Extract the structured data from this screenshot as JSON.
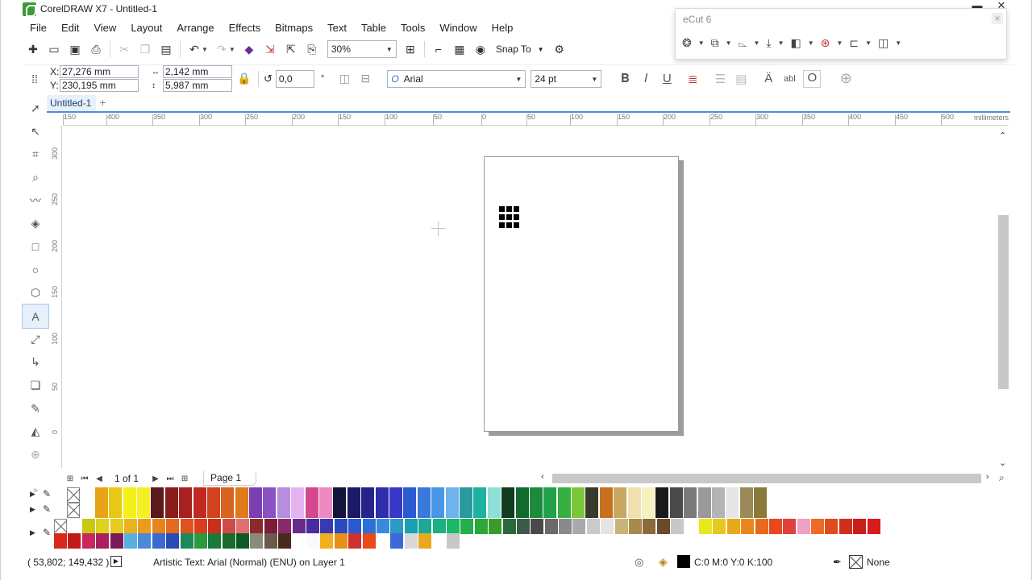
{
  "window": {
    "title": "CorelDRAW X7 - Untitled-1"
  },
  "menu": [
    "File",
    "Edit",
    "View",
    "Layout",
    "Arrange",
    "Effects",
    "Bitmaps",
    "Text",
    "Table",
    "Tools",
    "Window",
    "Help"
  ],
  "toolbar": {
    "zoom_value": "30%",
    "snap_label": "Snap To"
  },
  "ecut": {
    "title": "eCut 6"
  },
  "properties": {
    "x_label": "X:",
    "x_value": "27,276 mm",
    "y_label": "Y:",
    "y_value": "230,195 mm",
    "width_value": "2,142 mm",
    "height_value": "5,987 mm",
    "angle_value": "0,0",
    "angle_unit": "°",
    "font_name": "Arial",
    "font_size": "24 pt"
  },
  "document": {
    "tab_label": "Untitled-1"
  },
  "hruler": {
    "ticks": [
      "150",
      "400",
      "350",
      "300",
      "250",
      "200",
      "150",
      "100",
      "50",
      "0",
      "50",
      "100",
      "150",
      "200",
      "250",
      "300",
      "350",
      "400",
      "450",
      "500"
    ],
    "units": "millimeters"
  },
  "vruler": {
    "ticks": [
      "300",
      "250",
      "200",
      "150",
      "100",
      "50",
      "0"
    ],
    "units": "millimeters"
  },
  "page_nav": {
    "count": "1 of 1",
    "page_tab": "Page 1"
  },
  "palette": {
    "row1": [
      "#ffffff",
      "#e8a417",
      "#e8c814",
      "#f5f01a",
      "#f5f026",
      "#5a1a1a",
      "#8a1c1c",
      "#a82020",
      "#c02a22",
      "#d0431e",
      "#d96420",
      "#e07a1c",
      "#7a3fb0",
      "#8b52c5",
      "#b58ee0",
      "#e3b4f0",
      "#d4488e",
      "#ee88c0",
      "#14143a",
      "#1a1a66",
      "#24248a",
      "#2e2eaa",
      "#3838c8",
      "#2c5ad0",
      "#3a78dc",
      "#4a96e6",
      "#70b2ee",
      "#2a9a9e",
      "#1eb2a2",
      "#8ee0d6",
      "#123c20",
      "#126a2e",
      "#1a8c3c",
      "#22a04a",
      "#36b040",
      "#7ac83a",
      "#3a3a2a",
      "#c87020",
      "#c8a860",
      "#f0e0b0",
      "#f6f0c0",
      "#1a1a1a",
      "#4a4a4a",
      "#7a7a7a",
      "#9a9a9a",
      "#b4b4b4",
      "#e6e6e6",
      "#9a8a5a",
      "#8a7a3a"
    ],
    "row2": [
      "#ffffff",
      "#e8a417",
      "#e8c814",
      "#f5f01a",
      "#f5f026",
      "#5a1a1a",
      "#8a1c1c",
      "#a82020",
      "#c02a22",
      "#d0431e",
      "#d96420",
      "#e07a1c",
      "#7a3fb0",
      "#8b52c5",
      "#b58ee0",
      "#e3b4f0",
      "#d4488e",
      "#ee88c0",
      "#14143a",
      "#1a1a66",
      "#24248a",
      "#2e2eaa",
      "#3838c8",
      "#2c5ad0",
      "#3a78dc",
      "#4a96e6",
      "#70b2ee",
      "#2a9a9e",
      "#1eb2a2",
      "#8ee0d6",
      "#123c20",
      "#126a2e",
      "#1a8c3c",
      "#22a04a",
      "#36b040",
      "#7ac83a",
      "#3a3a2a",
      "#c87020",
      "#c8a860",
      "#f0e0b0",
      "#f6f0c0",
      "#1a1a1a",
      "#4a4a4a",
      "#7a7a7a",
      "#9a9a9a",
      "#b4b4b4",
      "#e6e6e6",
      "#9a8a5a",
      "#8a7a3a"
    ],
    "row3": [
      "#ffffff",
      "#c8c814",
      "#dcd41c",
      "#e4cc20",
      "#e8b41c",
      "#ec9c1a",
      "#e8841c",
      "#e46a1e",
      "#e0521e",
      "#d83e1e",
      "#cc2e1e",
      "#d04a4a",
      "#e07070",
      "#8a2a2a",
      "#7a1c3a",
      "#8a2a6a",
      "#6a2a8a",
      "#4a2aa0",
      "#3a3ab0",
      "#2a4ac0",
      "#2a5ad0",
      "#2a70d8",
      "#3a8adc",
      "#2a9ac8",
      "#1aa0b0",
      "#1aa89a",
      "#1ab084",
      "#1ab868",
      "#22b04a",
      "#2aa83a",
      "#3a9a2a",
      "#2a6a3a",
      "#3a5a4a",
      "#4a4a4a",
      "#6a6a6a",
      "#8a8a8a",
      "#aaaaaa",
      "#cacaca",
      "#e4e4e4",
      "#c8b478",
      "#a88a4a",
      "#8a6a3a",
      "#6a4a2a",
      "#c8c8c8",
      "#ffffff",
      "#e8e81c",
      "#e8c81c",
      "#e8a81c",
      "#e8881c",
      "#e8681c",
      "#e8481c",
      "#e04040",
      "#f0a0c0",
      "#ee6a2a",
      "#e04a1c",
      "#d0301a",
      "#c81e1e",
      "#d81c1c"
    ],
    "row4": [
      "#d82a1a",
      "#c21a1a",
      "#c8285a",
      "#a82060",
      "#7a1a5a",
      "#5aaee0",
      "#4a8ad8",
      "#3a6acc",
      "#2a4ab8",
      "#1a8a5a",
      "#2a9a3a",
      "#1a7a3a",
      "#1a6a2a",
      "#0a5a2a",
      "#8a8a7a",
      "#6a5a4a",
      "#4a2a1a",
      "#ffffff",
      "#fafafa",
      "#f0b020",
      "#e8901c",
      "#d03030",
      "#e84a1a",
      "#ffffff",
      "#3a6ad8",
      "#d8d8d8",
      "#e8a820",
      "#ffffff",
      "#c8c8c8"
    ]
  },
  "status": {
    "coords": "( 53,802; 149,432 )",
    "info": "Artistic Text: Arial (Normal) (ENU) on Layer 1",
    "fill": "C:0 M:0 Y:0 K:100",
    "outline": "None",
    "fill_color": "#000000"
  },
  "colors": {
    "accent": "#4a90d9",
    "title_logo": "#3a9a36"
  }
}
